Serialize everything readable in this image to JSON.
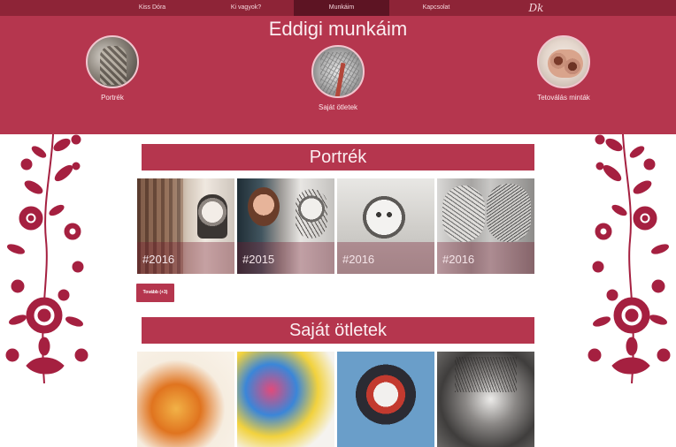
{
  "nav": {
    "items": [
      {
        "label": "Kiss Dóra"
      },
      {
        "label": "Ki vagyok?"
      },
      {
        "label": "Munkáim"
      },
      {
        "label": "Kapcsolat"
      }
    ],
    "logo_text": "Dk"
  },
  "hero": {
    "title": "Eddigi munkáim",
    "categories": [
      {
        "label": "Portrék"
      },
      {
        "label": "Saját ötletek"
      },
      {
        "label": "Tetoválás minták"
      }
    ]
  },
  "sections": [
    {
      "title": "Portrék",
      "thumbs": [
        {
          "year": "#2016"
        },
        {
          "year": "#2015"
        },
        {
          "year": "#2016"
        },
        {
          "year": "#2016"
        }
      ],
      "more_label": "Tovább (+3)"
    },
    {
      "title": "Saját ötletek"
    }
  ],
  "colors": {
    "nav": "#8e2437",
    "nav_active": "#5d1423",
    "accent": "#b5364e",
    "ornament": "#a52040"
  }
}
